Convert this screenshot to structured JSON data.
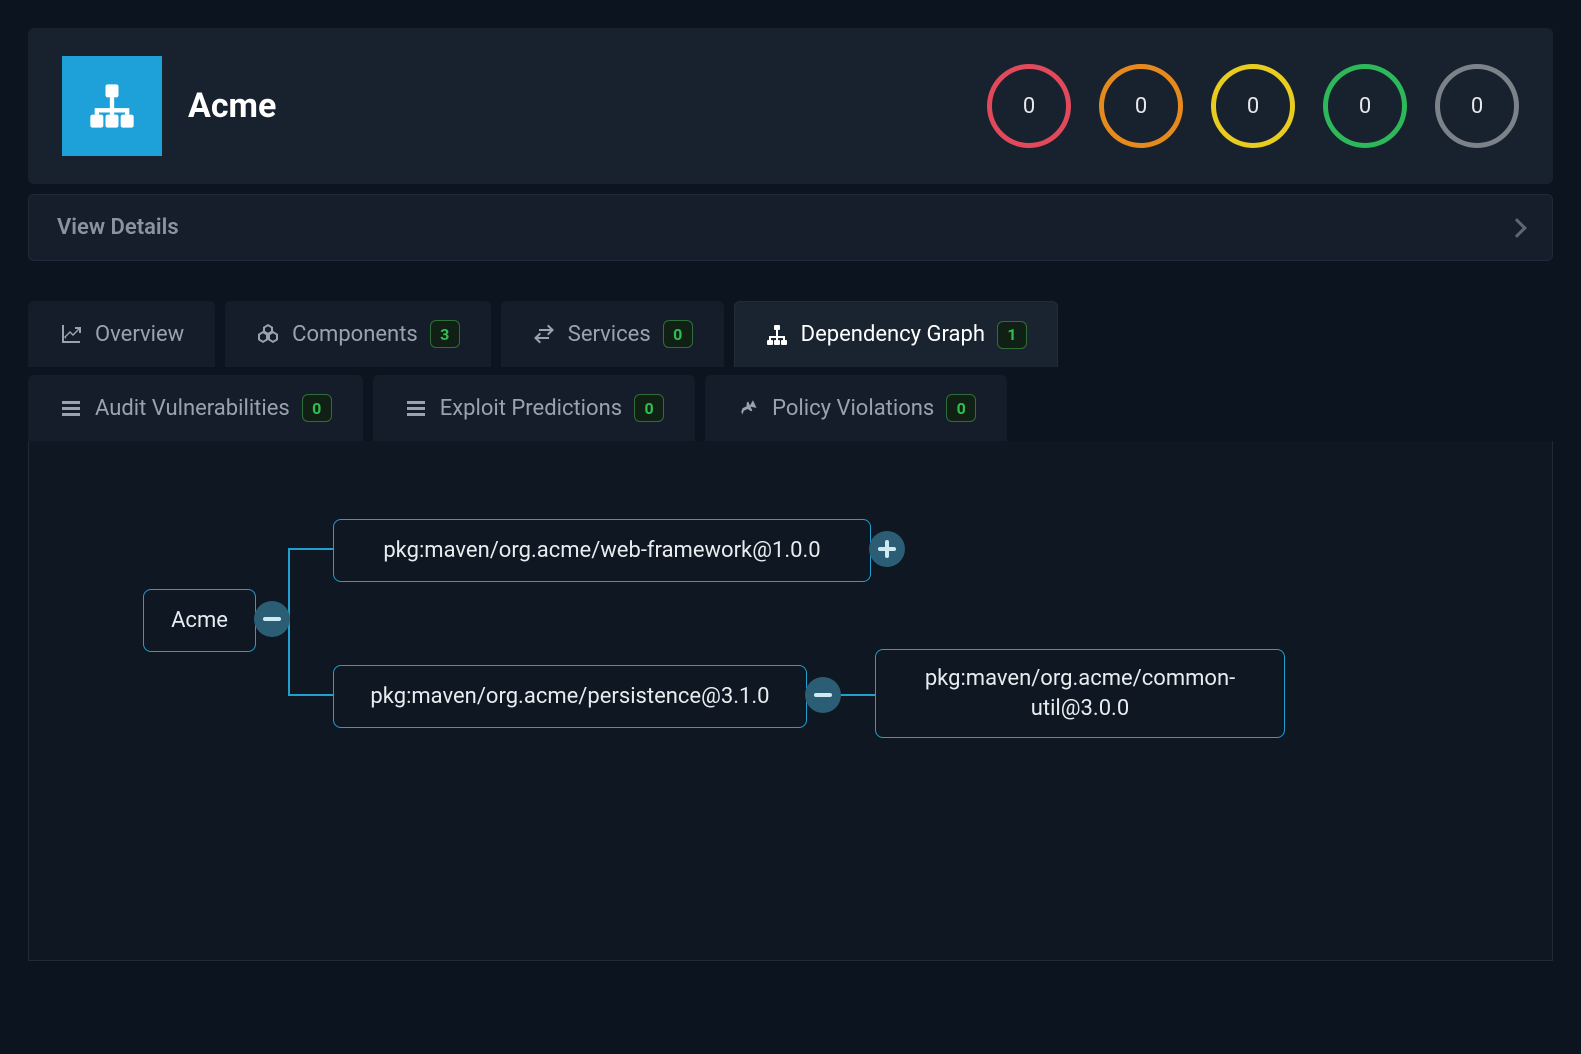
{
  "header": {
    "project_name": "Acme",
    "rings": [
      {
        "value": "0",
        "color": "#e24a5c"
      },
      {
        "value": "0",
        "color": "#e68a1e"
      },
      {
        "value": "0",
        "color": "#e8cc1f"
      },
      {
        "value": "0",
        "color": "#2db85a"
      },
      {
        "value": "0",
        "color": "#7b8289"
      }
    ]
  },
  "details": {
    "label": "View Details"
  },
  "tabs": {
    "row1": [
      {
        "icon": "chart-line-icon",
        "label": "Overview",
        "badge": null,
        "active": false
      },
      {
        "icon": "cubes-icon",
        "label": "Components",
        "badge": "3",
        "active": false
      },
      {
        "icon": "exchange-icon",
        "label": "Services",
        "badge": "0",
        "active": false
      },
      {
        "icon": "sitemap-icon",
        "label": "Dependency Graph",
        "badge": "1",
        "active": true
      }
    ],
    "row2": [
      {
        "icon": "tasks-icon",
        "label": "Audit Vulnerabilities",
        "badge": "0",
        "active": false
      },
      {
        "icon": "tasks-icon",
        "label": "Exploit Predictions",
        "badge": "0",
        "active": false
      },
      {
        "icon": "thumbtack-icon",
        "label": "Policy Violations",
        "badge": "0",
        "active": false
      }
    ]
  },
  "graph": {
    "root": {
      "label": "Acme"
    },
    "child1": {
      "label": "pkg:maven/org.acme/web-framework@1.0.0",
      "expand": "plus"
    },
    "child2": {
      "label": "pkg:maven/org.acme/persistence@3.1.0",
      "expand": "minus"
    },
    "grandchild": {
      "label": "pkg:maven/org.acme/common-util@3.0.0"
    },
    "root_toggle": "minus"
  }
}
